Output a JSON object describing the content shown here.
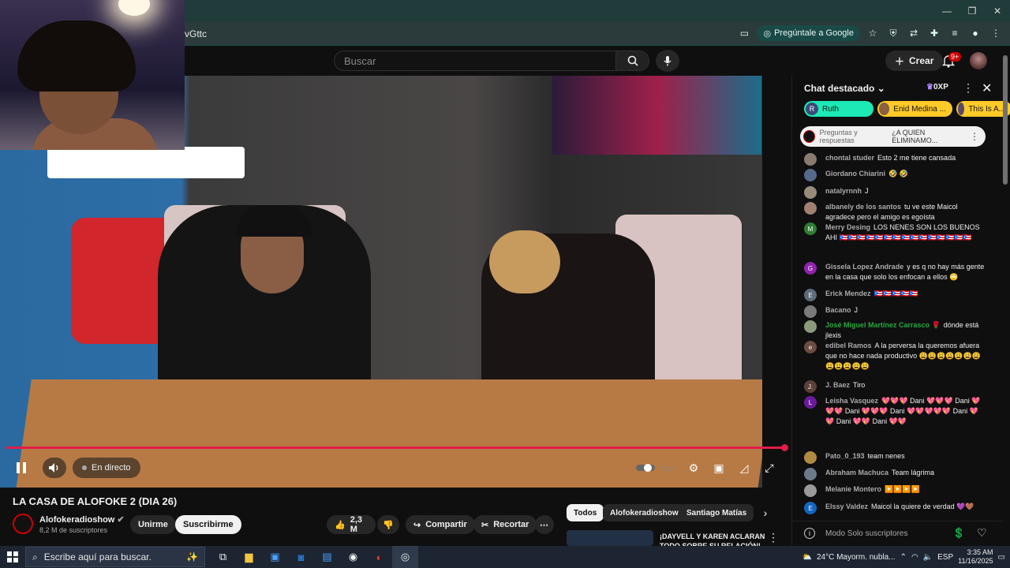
{
  "browser": {
    "url_fragment": "vGttc",
    "google_pill": "Pregúntale a Google",
    "window_controls": [
      "—",
      "❐",
      "✕"
    ]
  },
  "yt": {
    "search_placeholder": "Buscar",
    "create_label": "Crear",
    "notif_badge": "9+"
  },
  "player": {
    "live_label": "En directo"
  },
  "video": {
    "title": "LA CASA DE ALOFOKE 2 (DIA 26)",
    "channel": "Alofokeradioshow",
    "subscribers": "8,2 M de suscriptores",
    "join_label": "Unirme",
    "subscribe_label": "Suscribirme",
    "likes": "2,3 M",
    "share_label": "Compartir",
    "clip_label": "Recortar"
  },
  "recs": {
    "chips": [
      "Todos",
      "Alofokeradioshow",
      "Santiago Matías"
    ],
    "first_title": "¡DAYVELL Y KAREN ACLARAN TODO SOBRE SU RELACIÓN!"
  },
  "chat": {
    "title": "Chat destacado",
    "xp": "0XP",
    "tickers": [
      {
        "initial": "R",
        "name": "Ruth",
        "color": "#1de9b6"
      },
      {
        "initial": "",
        "name": "Enid Medina ...",
        "color": "#ffca28"
      },
      {
        "initial": "",
        "name": "This Is A...",
        "color": "#ffca28"
      }
    ],
    "pinned_label": "Preguntas y respuestas",
    "pinned_text": "¿A QUIEN ELIMINAMO...",
    "messages": [
      {
        "initial": "",
        "av_color": "#8a7a70",
        "author": "chontal studer",
        "text": "Esto 2 me tiene cansada",
        "green": false
      },
      {
        "initial": "",
        "av_color": "#556a8a",
        "author": "Giordano Chiarini",
        "text": "🤣 🤣",
        "green": false
      },
      {
        "initial": "",
        "av_color": "#9a8a7a",
        "author": "natalyrnnh",
        "text": "J",
        "green": false
      },
      {
        "initial": "",
        "av_color": "#a08070",
        "author": "albanely de los santos",
        "text": "tu ve este Maicol agradece pero el amigo es egoísta",
        "green": false
      },
      {
        "initial": "M",
        "av_color": "#2e7d32",
        "author": "Merry Desing",
        "text": "LOS NENES SON LOS BUENOS AHI 🇵🇷🇵🇷🇵🇷🇵🇷🇵🇷🇵🇷🇵🇷🇵🇷🇵🇷🇵🇷🇵🇷🇵🇷🇵🇷🇵🇷🇵🇷",
        "green": false
      },
      {
        "initial": "G",
        "av_color": "#8e24aa",
        "author": "Gissela Lopez Andrade",
        "text": "y es q no hay más gente en la casa que solo los enfocan a ellos 🙄",
        "green": false
      },
      {
        "initial": "E",
        "av_color": "#5c6b7a",
        "author": "Erick Mendez",
        "text": "🇵🇷🇵🇷🇵🇷🇵🇷🇵🇷",
        "green": false
      },
      {
        "initial": "",
        "av_color": "#7a7a7a",
        "author": "Bacano",
        "text": "J",
        "green": false
      },
      {
        "initial": "",
        "av_color": "#8a9a7a",
        "author": "José Miguel Martínez Carrasco 🌹",
        "text": "dónde está jlexis",
        "green": true
      },
      {
        "initial": "e",
        "av_color": "#6d4c41",
        "author": "edibel Ramos",
        "text": "A la perversa la queremos afuera que no hace nada productivo 😩😩😩😩😩😩😩😩😩😩😩😩",
        "green": false
      },
      {
        "initial": "J.",
        "av_color": "#5d4037",
        "author": "J. Baez",
        "text": "Tiro",
        "green": false
      },
      {
        "initial": "L",
        "av_color": "#6a1b9a",
        "author": "Leisha Vasquez",
        "text": "💖💖💖 Dani 💖💖💖 Dani 💖💖💖 Dani 💖💖💖 Dani 💖💖💖💖💖 Dani 💖💖 Dani 💖💖 Dani 💖💖",
        "green": false
      },
      {
        "initial": "",
        "av_color": "#b08a40",
        "author": "Pato_0_193",
        "text": "team nenes",
        "green": false
      },
      {
        "initial": "",
        "av_color": "#6a7a8a",
        "author": "Abraham Machuca",
        "text": "Team lágrima",
        "green": false
      },
      {
        "initial": "",
        "av_color": "#9a9a9a",
        "author": "Melanie Montero",
        "text": "▶️▶️▶️▶️",
        "green": false
      },
      {
        "initial": "E",
        "av_color": "#1565c0",
        "author": "Elssy Valdez",
        "text": "Maicol la quiere de verdad 💜🤎",
        "green": false
      }
    ],
    "input_placeholder": "Modo Solo suscriptores"
  },
  "taskbar": {
    "search_placeholder": "Escribe aquí para buscar.",
    "weather": "24°C  Mayorm. nubla...",
    "lang": "ESP",
    "time": "3:35 AM",
    "date": "11/16/2025"
  }
}
